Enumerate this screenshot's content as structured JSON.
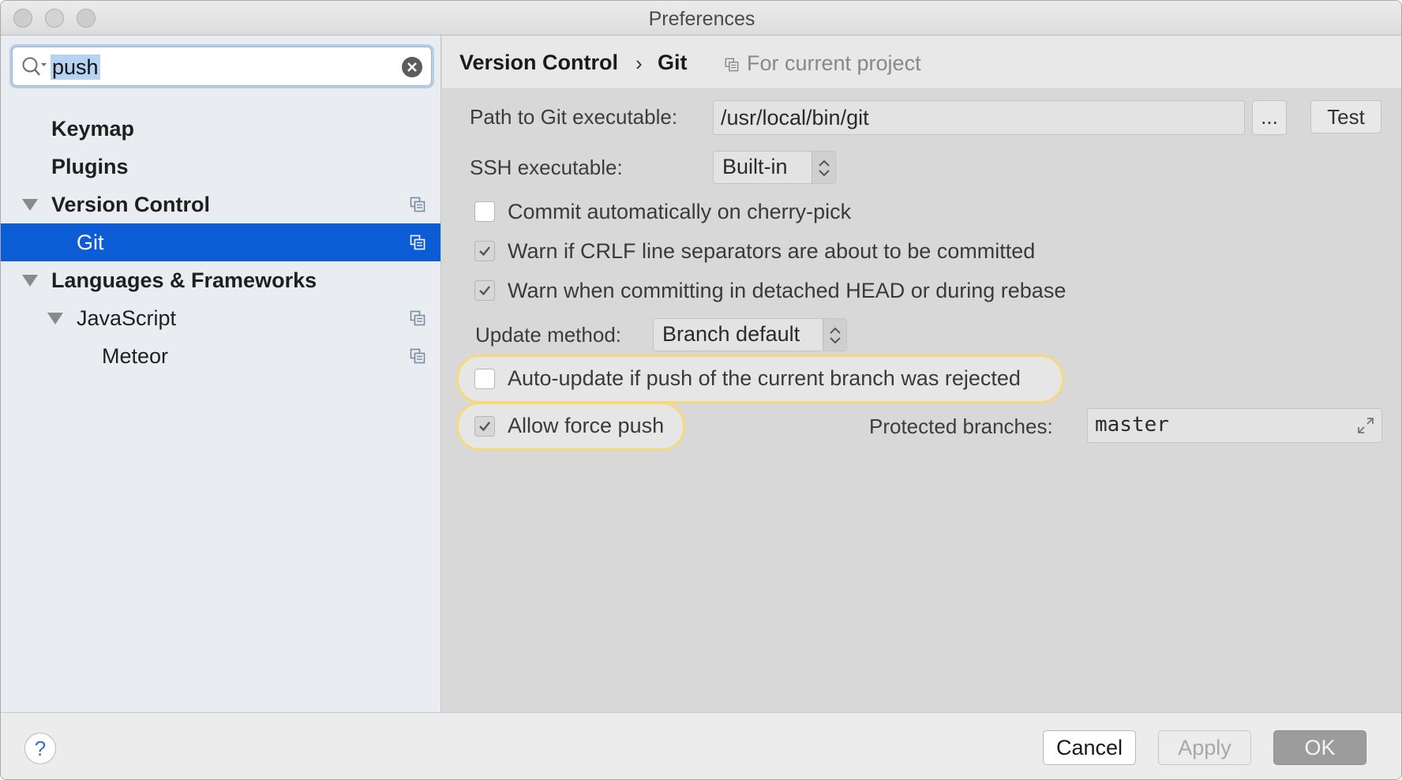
{
  "window": {
    "title": "Preferences"
  },
  "sidebar": {
    "search": {
      "value": "push"
    },
    "items": [
      {
        "label": "Keymap",
        "bold": true,
        "project_icon": false,
        "selected": false
      },
      {
        "label": "Plugins",
        "bold": true,
        "project_icon": false,
        "selected": false
      },
      {
        "label": "Version Control",
        "bold": true,
        "project_icon": true,
        "expanded": true,
        "selected": false
      },
      {
        "label": "Git",
        "bold": false,
        "project_icon": true,
        "selected": true
      },
      {
        "label": "Languages & Frameworks",
        "bold": true,
        "project_icon": false,
        "expanded": true,
        "selected": false
      },
      {
        "label": "JavaScript",
        "bold": false,
        "project_icon": true,
        "expanded": true,
        "selected": false
      },
      {
        "label": "Meteor",
        "bold": false,
        "project_icon": true,
        "selected": false
      }
    ]
  },
  "breadcrumb": {
    "parent": "Version Control",
    "separator": "›",
    "current": "Git",
    "scope_note": "For current project"
  },
  "git": {
    "path_label": "Path to Git executable:",
    "path_value": "/usr/local/bin/git",
    "browse_label": "...",
    "test_label": "Test",
    "ssh_label": "SSH executable:",
    "ssh_value": "Built-in",
    "options": [
      {
        "label": "Commit automatically on cherry-pick",
        "checked": false
      },
      {
        "label": "Warn if CRLF line separators are about to be committed",
        "checked": true
      },
      {
        "label": "Warn when committing in detached HEAD or during rebase",
        "checked": true
      }
    ],
    "update_method_label": "Update method:",
    "update_method_value": "Branch default",
    "auto_update": {
      "label": "Auto-update if push of the current branch was rejected",
      "checked": false
    },
    "force_push": {
      "label": "Allow force push",
      "checked": true
    },
    "protected_label": "Protected branches:",
    "protected_value": "master"
  },
  "footer": {
    "help_label": "?",
    "cancel_label": "Cancel",
    "apply_label": "Apply",
    "ok_label": "OK"
  },
  "colors": {
    "selection": "#0c5cd6",
    "highlight_ring": "#f6d97a",
    "ok_button": "#9c9c9c"
  }
}
